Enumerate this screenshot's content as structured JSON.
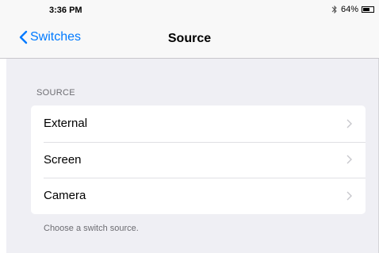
{
  "status_bar": {
    "time": "3:36 PM",
    "battery_percent": "64%",
    "battery_level": 0.64,
    "icons": [
      "bluetooth-icon",
      "battery-icon"
    ]
  },
  "nav": {
    "back_label": "Switches",
    "title": "Source",
    "accent_color": "#007aff"
  },
  "section": {
    "header": "SOURCE",
    "items": [
      {
        "label": "External"
      },
      {
        "label": "Screen"
      },
      {
        "label": "Camera"
      }
    ],
    "footer": "Choose a switch source."
  }
}
